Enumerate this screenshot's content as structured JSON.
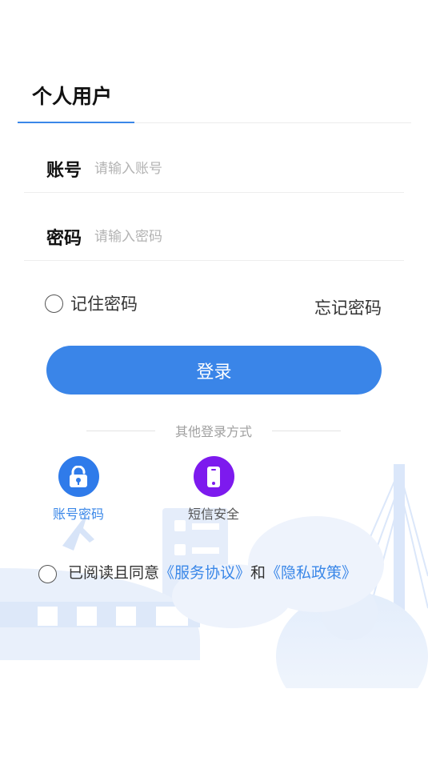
{
  "tabs": {
    "active_label": "个人用户"
  },
  "account": {
    "label": "账号",
    "placeholder": "请输入账号"
  },
  "password": {
    "label": "密码",
    "placeholder": "请输入密码"
  },
  "remember_label": "记住密码",
  "forgot_label": "忘记密码",
  "login_label": "登录",
  "other_methods": {
    "title": "其他登录方式",
    "items": [
      {
        "label": "账号密码",
        "icon": "lock-icon",
        "color": "#2f7bea",
        "selected": true
      },
      {
        "label": "短信安全",
        "icon": "phone-icon",
        "color": "#7d1aee",
        "selected": false
      }
    ]
  },
  "agreement": {
    "prefix": "已阅读且同意",
    "service_link": "《服务协议》",
    "conjunction": "和",
    "privacy_link": "《隐私政策》"
  },
  "colors": {
    "accent": "#3a85e8",
    "sms": "#7d1aee"
  }
}
